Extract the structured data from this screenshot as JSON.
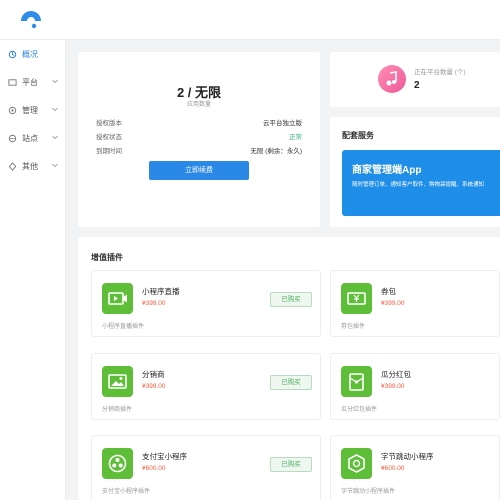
{
  "sidebar": {
    "items": [
      {
        "label": "概况",
        "icon": "dashboard-icon",
        "active": true
      },
      {
        "label": "平台",
        "icon": "platform-icon",
        "active": false
      },
      {
        "label": "管理",
        "icon": "manage-icon",
        "active": false
      },
      {
        "label": "站点",
        "icon": "site-icon",
        "active": false
      },
      {
        "label": "其他",
        "icon": "other-icon",
        "active": false
      }
    ]
  },
  "plan": {
    "value": "2 / 无限",
    "caption": "应用数量",
    "rows": [
      {
        "key": "授权版本",
        "value": "云平台独立版"
      },
      {
        "key": "授权状态",
        "value": "正常"
      },
      {
        "key": "到期时间",
        "value": "无限   (剩余：永久)"
      }
    ],
    "button": "立即续费"
  },
  "fav": {
    "label": "正在平台数量 (个)",
    "value": "2"
  },
  "service": {
    "title": "配套服务",
    "banner_title": "商家管理端App",
    "banner_desc": "随时管理订单、通知客户取件、购物袋提醒、系统通知"
  },
  "plugins": {
    "title": "增值插件",
    "items": [
      {
        "name": "小程序直播",
        "price": "¥399.00",
        "desc": "小程序直播插件",
        "button": "已购买",
        "icon": "live-video-icon"
      },
      {
        "name": "券包",
        "price": "¥399.00",
        "desc": "券包插件",
        "button": "",
        "icon": "coupon-icon"
      },
      {
        "name": "分销商",
        "price": "¥399.00",
        "desc": "分销商插件",
        "button": "已购买",
        "icon": "image-icon"
      },
      {
        "name": "瓜分红包",
        "price": "¥399.00",
        "desc": "瓜分红包插件",
        "button": "",
        "icon": "red-envelope-icon"
      },
      {
        "name": "支付宝小程序",
        "price": "¥600.00",
        "desc": "支付宝小程序插件",
        "button": "已购买",
        "icon": "alipay-icon"
      },
      {
        "name": "字节跳动小程序",
        "price": "¥600.00",
        "desc": "字节跳动小程序插件",
        "button": "",
        "icon": "bytedance-icon"
      }
    ]
  },
  "colors": {
    "primary": "#2a88e6",
    "plugin_green": "#5fbe38",
    "price_red": "#ff5a3d",
    "success_green": "#2bb673"
  }
}
